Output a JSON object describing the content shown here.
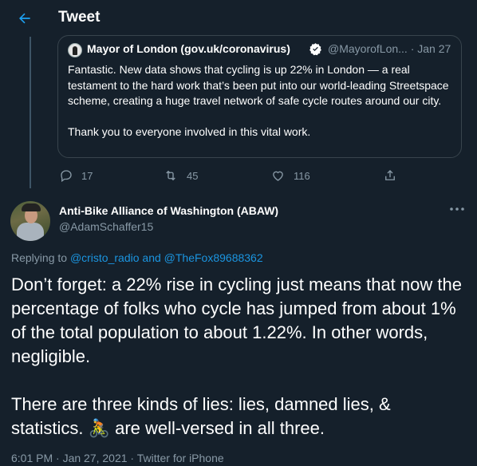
{
  "header": {
    "title": "Tweet",
    "back_icon": "arrow-left-icon"
  },
  "quoted_tweet": {
    "author_name": "Mayor of London (gov.uk/coronavirus)",
    "verified_icon": "verified-badge-icon",
    "handle_date": "@MayorofLon... · Jan 27",
    "paragraphs": [
      "Fantastic. New data shows that cycling is up 22% in London — a real testament to the hard work that’s been put into our world-leading Streetspace scheme, creating a huge travel network of safe cycle routes around our city.",
      "Thank you to everyone involved in this vital work."
    ]
  },
  "actions": {
    "reply_count": "17",
    "retweet_count": "45",
    "like_count": "116"
  },
  "tweet": {
    "author_name": "Anti-Bike Alliance of Washington (ABAW)",
    "handle": "@AdamSchaffer15",
    "replying_prefix": "Replying to ",
    "reply_to_1": "@cristo_radio",
    "replying_and": " and ",
    "reply_to_2": "@TheFox89688362",
    "paragraph_1": "Don’t forget: a 22% rise in cycling just means that now the percentage of folks who cycle has jumped from about 1% of the total population to about 1.22%. In other words, negligible.",
    "paragraph_2_before": "There are three kinds of lies: lies, damned lies, & statistics. ",
    "emoji": "🚴",
    "paragraph_2_after": " are well-versed in all three.",
    "timestamp": "6:01 PM · Jan 27, 2021 · Twitter for iPhone"
  },
  "colors": {
    "background": "#15202b",
    "accent": "#1da1f2",
    "secondary_text": "#8899a6",
    "border": "#38444d"
  }
}
